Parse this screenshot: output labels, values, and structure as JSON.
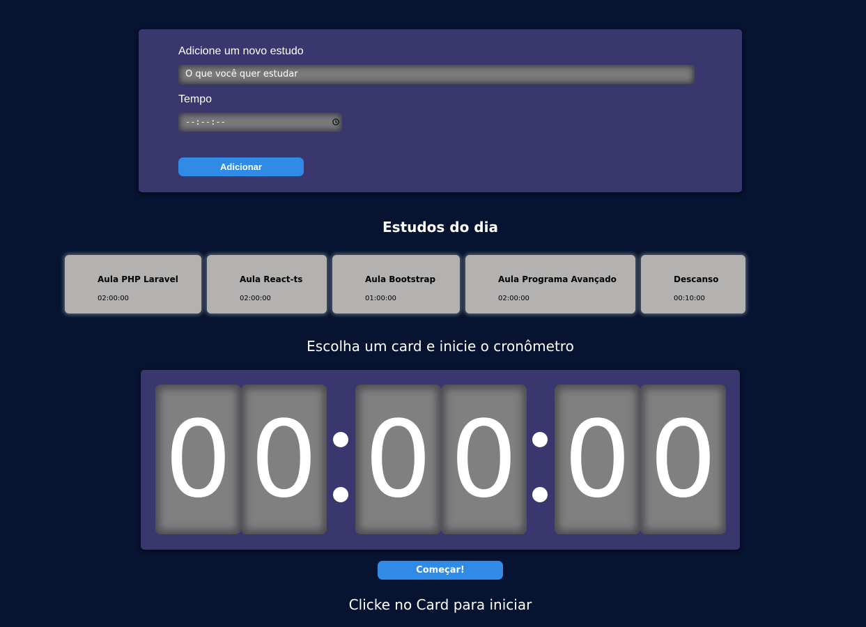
{
  "form": {
    "study_label": "Adicione um novo estudo",
    "study_placeholder": "O que você quer estudar",
    "time_label": "Tempo",
    "time_value": "--:--:--",
    "time_icon": "clock-icon",
    "add_button": "Adicionar"
  },
  "studies": {
    "heading": "Estudos do dia",
    "cards": [
      {
        "title": "Aula PHP Laravel",
        "time": "02:00:00"
      },
      {
        "title": "Aula React-ts",
        "time": "02:00:00"
      },
      {
        "title": "Aula Bootstrap",
        "time": "01:00:00"
      },
      {
        "title": "Aula Programa Avançado",
        "time": "02:00:00"
      },
      {
        "title": "Descanso",
        "time": "00:10:00"
      }
    ]
  },
  "timer": {
    "heading": "Escolha um card e inicie o cronômetro",
    "digits": [
      "0",
      "0",
      "0",
      "0",
      "0",
      "0"
    ],
    "start_button": "Começar!"
  },
  "footer": {
    "hint": "Clicke no Card para iniciar"
  },
  "colors": {
    "background": "#061331",
    "panel": "#3a376e",
    "accent": "#2f8be6",
    "card": "#b4b2b1"
  }
}
